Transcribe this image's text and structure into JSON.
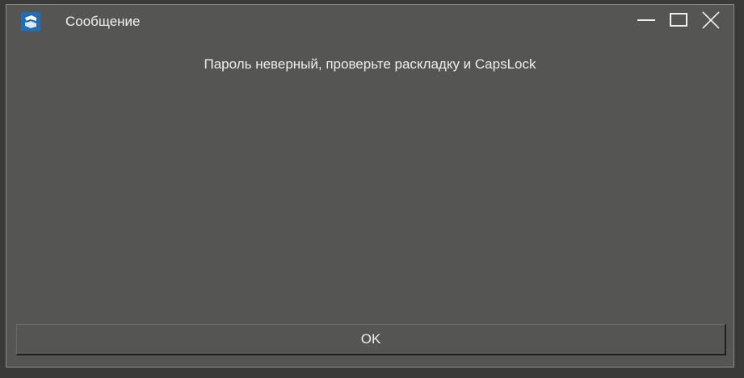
{
  "window": {
    "title": "Сообщение",
    "app_icon": "app-logo-icon",
    "controls": {
      "minimize_icon": "minimize-icon",
      "maximize_icon": "maximize-icon",
      "close_icon": "close-icon"
    }
  },
  "dialog": {
    "message": "Пароль неверный, проверьте раскладку и CapsLock",
    "ok_label": "OK"
  },
  "colors": {
    "window_bg": "#555553",
    "outer_bg": "#3a3a39",
    "text": "#eeeeee",
    "icon_blue": "#1e6fb8"
  }
}
